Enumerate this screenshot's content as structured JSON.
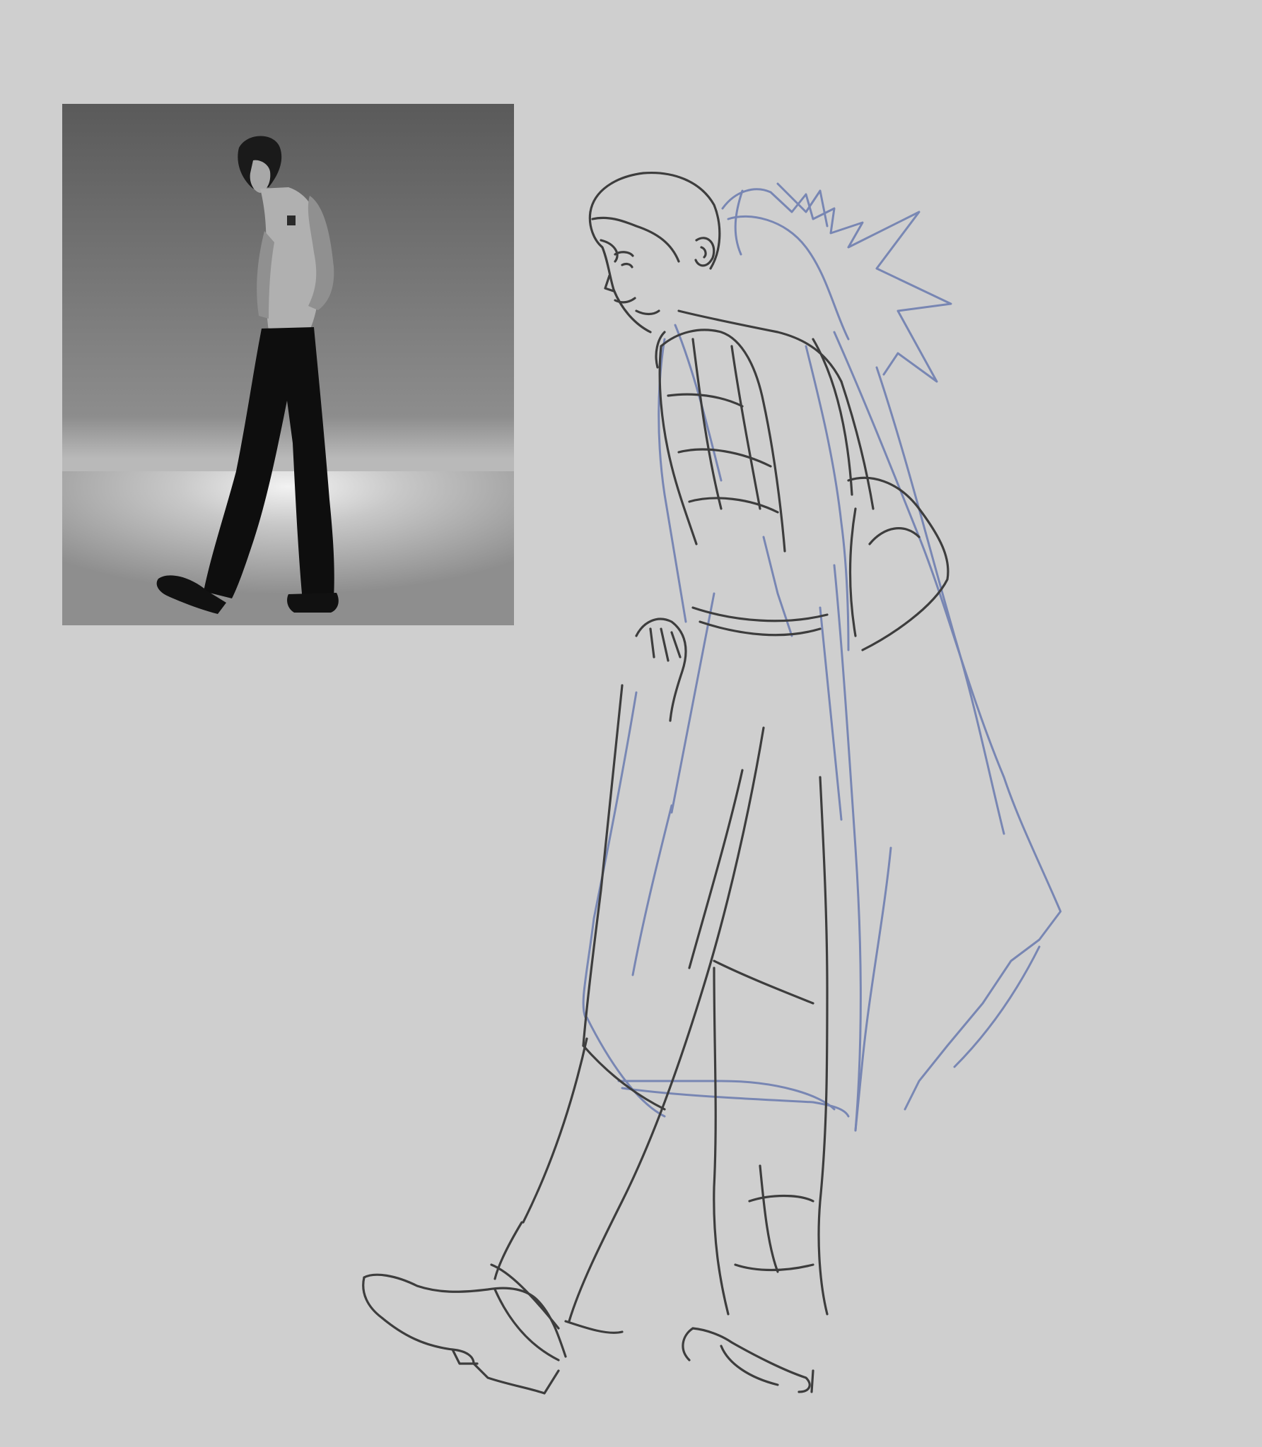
{
  "canvas": {
    "background_color": "#cfcfcf"
  },
  "reference_photo": {
    "tone": "grayscale",
    "backdrop_top_color": "#5e5e5e",
    "backdrop_mid_color": "#8a8a8a",
    "floor_glow_color": "#e8e8e8",
    "floor_color": "#9c9c9c",
    "figure_color": "#0e0e0e",
    "skin_color": "#a7a7a7"
  },
  "sketch": {
    "pose_lines_color": "#3d3d3d",
    "construction_lines_color": "#6f7fb0"
  }
}
